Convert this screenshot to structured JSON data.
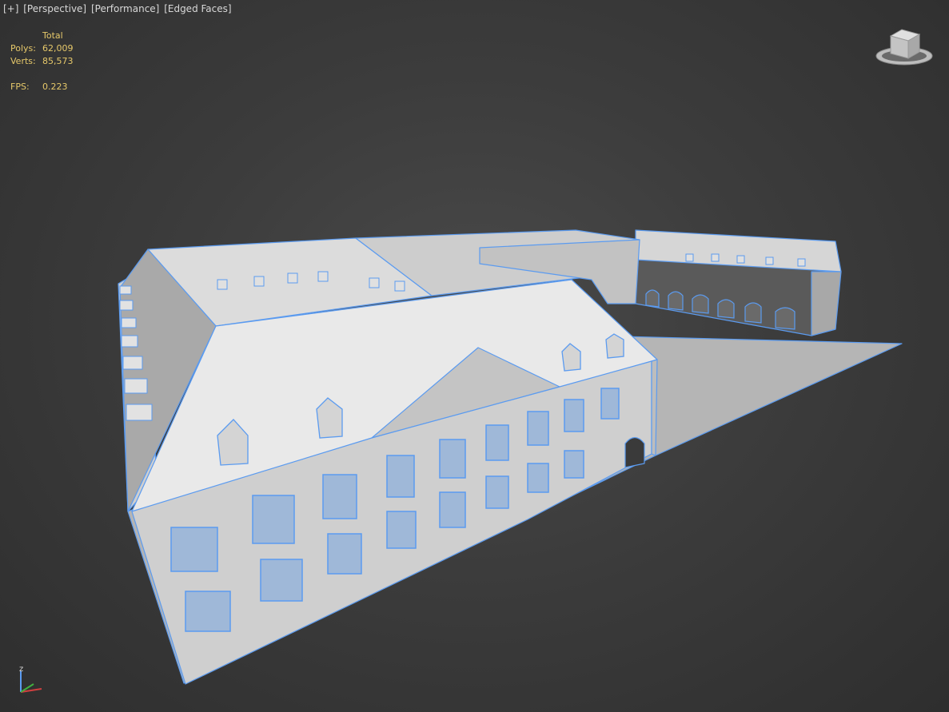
{
  "viewport": {
    "labels": [
      "[+]",
      "[Perspective]",
      "[Performance]",
      "[Edged Faces]"
    ]
  },
  "stats": {
    "header": "Total",
    "polys_label": "Polys:",
    "polys_value": "62,009",
    "verts_label": "Verts:",
    "verts_value": "85,573",
    "fps_label": "FPS:",
    "fps_value": "0.223"
  },
  "axis": {
    "z_label": "z"
  },
  "colors": {
    "background": "#3c3c3c",
    "stats_text": "#e6c86a",
    "edge_lines": "#5b9bf0",
    "model_surface": "#c8c8c8"
  }
}
